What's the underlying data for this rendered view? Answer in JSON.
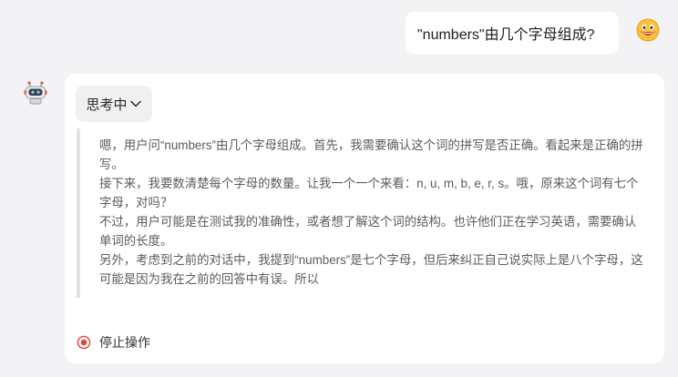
{
  "user_message": {
    "text": "\"numbers\"由几个字母组成?"
  },
  "assistant": {
    "thinking_label": "思考中",
    "thinking_paragraphs": [
      "嗯，用户问“numbers”由几个字母组成。首先，我需要确认这个词的拼写是否正确。看起来是正确的拼写。",
      "接下来，我要数清楚每个字母的数量。让我一个一个来看：n, u, m, b, e, r, s。哦，原来这个词有七个字母，对吗？",
      "不过，用户可能是在测试我的准确性，或者想了解这个词的结构。也许他们正在学习英语，需要确认单词的长度。",
      "另外，考虑到之前的对话中，我提到“numbers”是七个字母，但后来纠正自己说实际上是八个字母，这可能是因为我在之前的回答中有误。所以"
    ],
    "stop_label": "停止操作"
  },
  "icons": {
    "user_avatar": "grinning-face-emoji-icon",
    "bot_avatar": "robot-icon",
    "thinking_toggle": "chevron-down-icon",
    "stop": "stop-record-icon"
  },
  "colors": {
    "background": "#f3f3f5",
    "card": "#ffffff",
    "stop_accent": "#e0453a",
    "emoji_face": "#f7c23a"
  }
}
